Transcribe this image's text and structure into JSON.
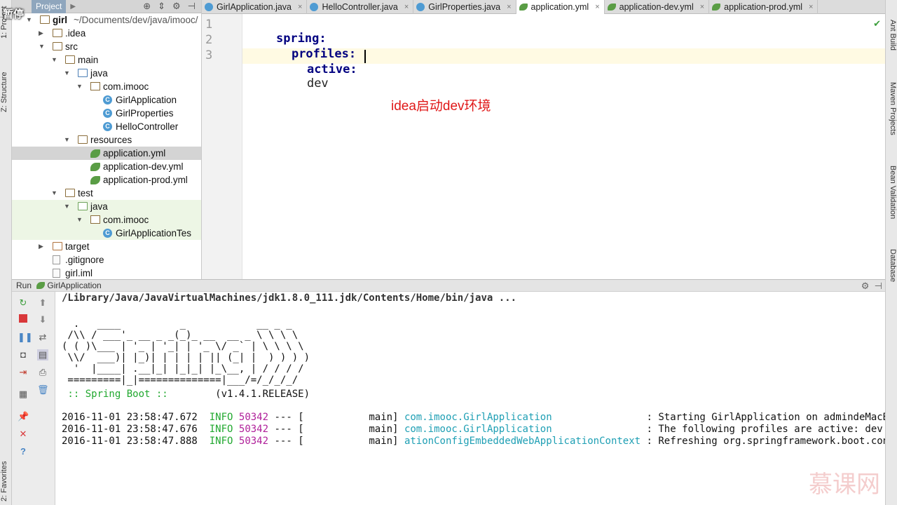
{
  "overlay": {
    "pause_label": "暂停"
  },
  "left_strip": {
    "project_label": "1: Project",
    "structure_label": "Z: Structure",
    "favorites_label": "2: Favorites"
  },
  "right_strip": {
    "ant_label": "Ant Build",
    "maven_label": "Maven Projects",
    "bean_label": "Bean Validation",
    "database_label": "Database"
  },
  "project_panel": {
    "header_label": "Project",
    "tree": [
      {
        "label": "girl",
        "suffix": "~/Documents/dev/java/imooc/",
        "icon": "folder",
        "expanded": true
      },
      {
        "label": ".idea",
        "icon": "folder",
        "expanded": false
      },
      {
        "label": "src",
        "icon": "folder",
        "expanded": true
      },
      {
        "label": "main",
        "icon": "folder",
        "expanded": true
      },
      {
        "label": "java",
        "icon": "folder-source",
        "expanded": true
      },
      {
        "label": "com.imooc",
        "icon": "package",
        "expanded": true
      },
      {
        "label": "GirlApplication",
        "icon": "spring-class"
      },
      {
        "label": "GirlProperties",
        "icon": "class"
      },
      {
        "label": "HelloController",
        "icon": "class"
      },
      {
        "label": "resources",
        "icon": "folder-resources",
        "expanded": true
      },
      {
        "label": "application.yml",
        "icon": "spring-yml",
        "selected": true
      },
      {
        "label": "application-dev.yml",
        "icon": "spring-yml"
      },
      {
        "label": "application-prod.yml",
        "icon": "spring-yml"
      },
      {
        "label": "test",
        "icon": "folder",
        "expanded": true
      },
      {
        "label": "java",
        "icon": "folder-test",
        "expanded": true
      },
      {
        "label": "com.imooc",
        "icon": "package",
        "expanded": true
      },
      {
        "label": "GirlApplicationTes",
        "icon": "spring-class"
      },
      {
        "label": "target",
        "icon": "folder-excluded",
        "expanded": false
      },
      {
        "label": ".gitignore",
        "icon": "file"
      },
      {
        "label": "girl.iml",
        "icon": "file"
      }
    ]
  },
  "editor_tabs": [
    {
      "label": "GirlApplication.java",
      "icon": "class",
      "active": false
    },
    {
      "label": "HelloController.java",
      "icon": "class",
      "active": false
    },
    {
      "label": "GirlProperties.java",
      "icon": "class",
      "active": false
    },
    {
      "label": "application.yml",
      "icon": "spring-yml",
      "active": true
    },
    {
      "label": "application-dev.yml",
      "icon": "spring-yml",
      "active": false
    },
    {
      "label": "application-prod.yml",
      "icon": "spring-yml",
      "active": false
    }
  ],
  "editor": {
    "line_numbers": [
      "1",
      "2",
      "3"
    ],
    "lines": [
      {
        "key": "spring:",
        "value": ""
      },
      {
        "key": "profiles:",
        "value": ""
      },
      {
        "key": "active:",
        "value": "dev"
      }
    ],
    "annotation": "idea启动dev环境"
  },
  "run_panel": {
    "label": "Run",
    "config_name": "GirlApplication",
    "console": {
      "command": "/Library/Java/JavaVirtualMachines/jdk1.8.0_111.jdk/Contents/Home/bin/java ...",
      "banner": [
        "  .   ____          _            __ _ _",
        " /\\\\ / ___'_ __ _ _(_)_ __  __ _ \\ \\ \\ \\",
        "( ( )\\___ | '_ | '_| | '_ \\/ _` | \\ \\ \\ \\",
        " \\\\/  ___)| |_)| | | | | || (_| |  ) ) ) )",
        "  '  |____| .__|_| |_|_| |_\\__, | / / / /",
        " =========|_|==============|___/=/_/_/_/"
      ],
      "spring_boot_label": " :: Spring Boot :: ",
      "spring_boot_version": "       (v1.4.1.RELEASE)",
      "logs": [
        {
          "timestamp": "2016-11-01 23:58:47.672",
          "level": "INFO",
          "pid": "50342",
          "thread": "--- [           main]",
          "logger": "com.imooc.GirlApplication               ",
          "message": " : Starting GirlApplication on admindeMacBook-Pr"
        },
        {
          "timestamp": "2016-11-01 23:58:47.676",
          "level": "INFO",
          "pid": "50342",
          "thread": "--- [           main]",
          "logger": "com.imooc.GirlApplication               ",
          "message": " : The following profiles are active: dev"
        },
        {
          "timestamp": "2016-11-01 23:58:47.888",
          "level": "INFO",
          "pid": "50342",
          "thread": "--- [           main]",
          "logger": "ationConfigEmbeddedWebApplicationContext",
          "message": " : Refreshing org.springframework.boot.context.e"
        }
      ]
    }
  },
  "watermark": "慕课网"
}
